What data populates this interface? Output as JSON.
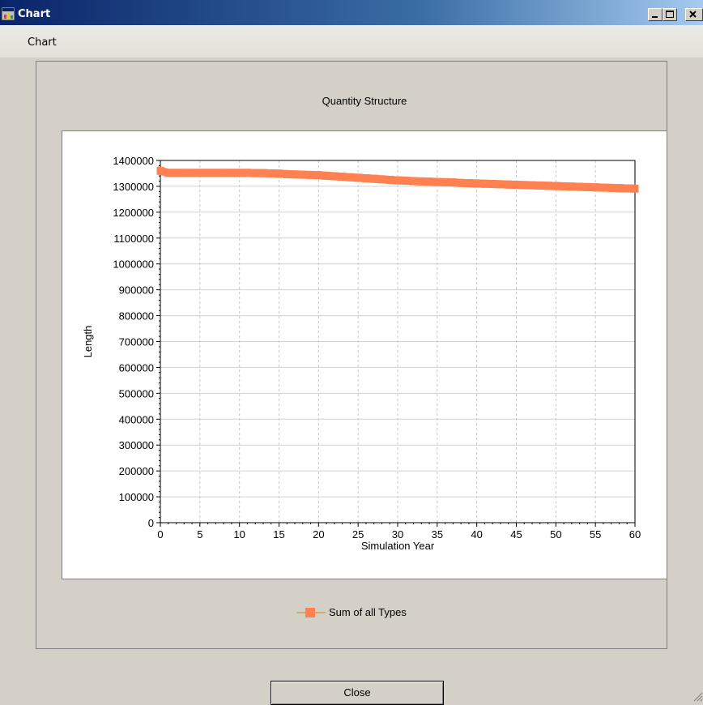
{
  "window": {
    "title": "Chart",
    "icon": "chart-app-icon"
  },
  "menu": {
    "items": [
      "Chart"
    ]
  },
  "chart_title": "Quantity Structure",
  "legend": {
    "label": "Sum of all Types"
  },
  "buttons": {
    "close_label": "Close"
  },
  "chart_data": {
    "type": "line",
    "title": "Quantity Structure",
    "xlabel": "Simulation Year",
    "ylabel": "Length",
    "xlim": [
      0,
      60
    ],
    "ylim": [
      0,
      1400000
    ],
    "x_ticks": [
      0,
      5,
      10,
      15,
      20,
      25,
      30,
      35,
      40,
      45,
      50,
      55,
      60
    ],
    "y_ticks": [
      0,
      100000,
      200000,
      300000,
      400000,
      500000,
      600000,
      700000,
      800000,
      900000,
      1000000,
      1100000,
      1200000,
      1300000,
      1400000
    ],
    "x_grid": "dashed",
    "y_grid": "solid",
    "legend_position": "bottom",
    "series": [
      {
        "name": "Sum of all Types",
        "color": "#ff8050",
        "x": [
          0,
          1,
          2,
          3,
          4,
          5,
          6,
          7,
          8,
          9,
          10,
          11,
          12,
          13,
          14,
          15,
          16,
          17,
          18,
          19,
          20,
          21,
          22,
          23,
          24,
          25,
          26,
          27,
          28,
          29,
          30,
          31,
          32,
          33,
          34,
          35,
          36,
          37,
          38,
          39,
          40,
          41,
          42,
          43,
          44,
          45,
          46,
          47,
          48,
          49,
          50,
          51,
          52,
          53,
          54,
          55,
          56,
          57,
          58,
          59,
          60
        ],
        "values": [
          1360000,
          1352000,
          1352000,
          1352000,
          1352000,
          1352000,
          1352000,
          1352000,
          1352000,
          1352000,
          1352000,
          1352000,
          1351000,
          1351000,
          1350000,
          1349000,
          1347000,
          1346000,
          1345000,
          1344000,
          1343000,
          1341000,
          1339000,
          1337000,
          1335000,
          1333000,
          1331000,
          1329000,
          1327000,
          1325000,
          1323000,
          1322000,
          1320000,
          1319000,
          1318000,
          1317000,
          1316000,
          1315000,
          1313000,
          1312000,
          1311000,
          1310000,
          1309000,
          1308000,
          1307000,
          1306000,
          1305000,
          1304000,
          1303000,
          1302000,
          1301000,
          1300000,
          1299000,
          1298000,
          1297000,
          1296000,
          1295000,
          1294000,
          1293000,
          1292000,
          1291000
        ]
      }
    ]
  }
}
